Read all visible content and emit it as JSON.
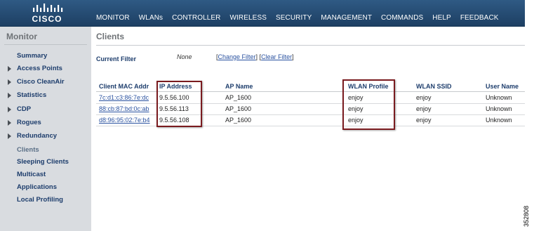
{
  "header": {
    "logo_text": "CISCO",
    "nav": [
      "MONITOR",
      "WLANs",
      "CONTROLLER",
      "WIRELESS",
      "SECURITY",
      "MANAGEMENT",
      "COMMANDS",
      "HELP",
      "FEEDBACK"
    ]
  },
  "sidebar": {
    "title": "Monitor",
    "items": [
      {
        "label": "Summary",
        "expandable": false
      },
      {
        "label": "Access Points",
        "expandable": true
      },
      {
        "label": "Cisco CleanAir",
        "expandable": true
      },
      {
        "label": "Statistics",
        "expandable": true
      },
      {
        "label": "CDP",
        "expandable": true
      },
      {
        "label": "Rogues",
        "expandable": true
      },
      {
        "label": "Redundancy",
        "expandable": true
      },
      {
        "label": "Clients",
        "expandable": false,
        "active": true
      },
      {
        "label": "Sleeping Clients",
        "expandable": false
      },
      {
        "label": "Multicast",
        "expandable": false
      },
      {
        "label": "Applications",
        "expandable": false
      },
      {
        "label": "Local Profiling",
        "expandable": false
      }
    ]
  },
  "main": {
    "title": "Clients",
    "filter": {
      "label": "Current Filter",
      "value": "None",
      "open_bracket": "[",
      "change_link": "Change Filter",
      "separator": "] [",
      "clear_link": "Clear Filter",
      "close_bracket": "]"
    },
    "table": {
      "columns": [
        "Client MAC Addr",
        "IP Address",
        "AP Name",
        "WLAN Profile",
        "WLAN SSID",
        "User Name"
      ],
      "rows": [
        [
          "7c:d1:c3:86:7e:dc",
          "9.5.56.100",
          "AP_1600",
          "enjoy",
          "enjoy",
          "Unknown"
        ],
        [
          "88:cb:87:bd:0c:ab",
          "9.5.56.113",
          "AP_1600",
          "enjoy",
          "enjoy",
          "Unknown"
        ],
        [
          "d8:96:95:02:7e:b4",
          "9.5.56.108",
          "AP_1600",
          "enjoy",
          "enjoy",
          "Unknown"
        ]
      ]
    }
  },
  "figure_code": "352808",
  "colors": {
    "header_bg": "#244b73",
    "sidebar_bg": "#d9dce0",
    "nav_text": "#1d3d6c",
    "link": "#2a52a0",
    "highlight_box": "#7a1b1f"
  }
}
